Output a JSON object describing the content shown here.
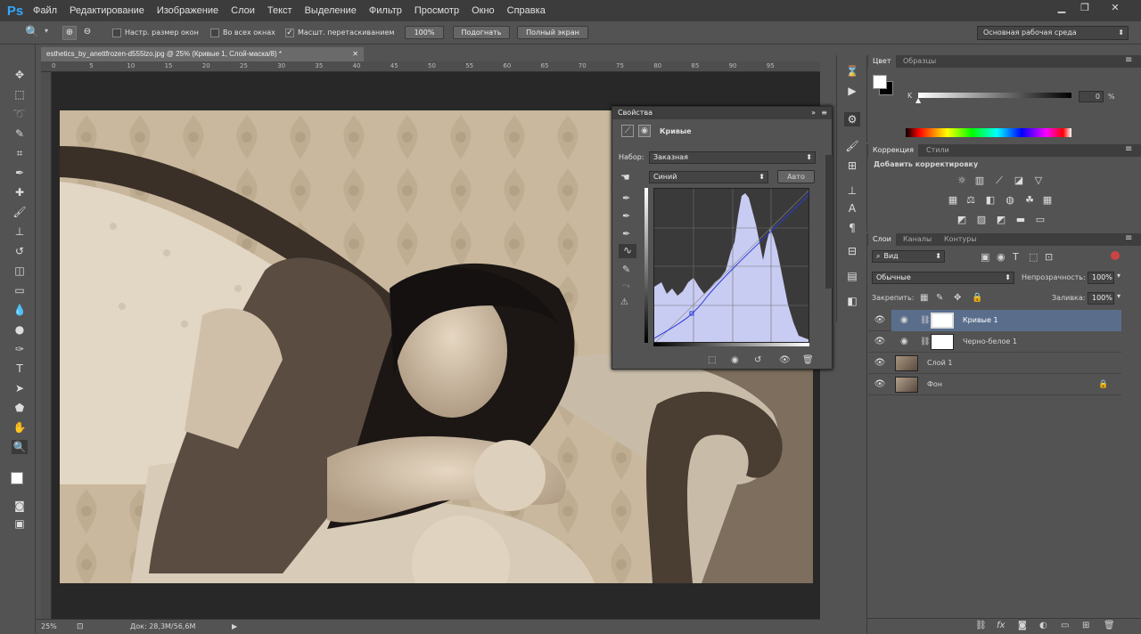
{
  "app": {
    "logo": "Ps"
  },
  "menu": [
    "Файл",
    "Редактирование",
    "Изображение",
    "Слои",
    "Текст",
    "Выделение",
    "Фильтр",
    "Просмотр",
    "Окно",
    "Справка"
  ],
  "options": {
    "resize_windows": "Настр. размер окон",
    "all_windows": "Во всех окнах",
    "scrubby_zoom": "Масшт. перетаскиванием",
    "zoom_value": "100%",
    "fit_label": "Подогнать",
    "fullscreen_label": "Полный экран",
    "workspace": "Основная рабочая среда"
  },
  "document": {
    "tab_title": "esthetics_by_anettfrozen-d555lzo.jpg @ 25% (Кривые 1, Слой-маска/8) *",
    "ruler_ticks": [
      "0",
      "5",
      "10",
      "15",
      "20",
      "25",
      "30",
      "35",
      "40",
      "45",
      "50",
      "55",
      "60",
      "65",
      "70",
      "75",
      "80",
      "85",
      "90",
      "95"
    ]
  },
  "status": {
    "zoom": "25%",
    "doc": "Док: 28,3M/56,6M"
  },
  "properties": {
    "title": "Свойства",
    "type": "Кривые",
    "preset_label": "Набор:",
    "preset_value": "Заказная",
    "channel": "Синий",
    "auto_label": "Авто"
  },
  "color_panel": {
    "tabs": [
      "Цвет",
      "Образцы"
    ],
    "k_label": "K",
    "k_value": "0",
    "k_unit": "%"
  },
  "adjustments_panel": {
    "tabs": [
      "Коррекция",
      "Стили"
    ],
    "heading": "Добавить корректировку"
  },
  "layers_panel": {
    "tabs": [
      "Слои",
      "Каналы",
      "Контуры"
    ],
    "filter_label": "Вид",
    "blend_mode": "Обычные",
    "opacity_label": "Непрозрачность:",
    "opacity_value": "100%",
    "lock_label": "Закрепить:",
    "fill_label": "Заливка:",
    "fill_value": "100%",
    "layers": [
      {
        "name": "Кривые 1"
      },
      {
        "name": "Черно-белое 1"
      },
      {
        "name": "Слой 1"
      },
      {
        "name": "Фон"
      }
    ]
  },
  "colors": {
    "accent": "#31a8ff",
    "selected_layer": "#5a6e8c",
    "curve_fill": "#c9ccf2"
  }
}
